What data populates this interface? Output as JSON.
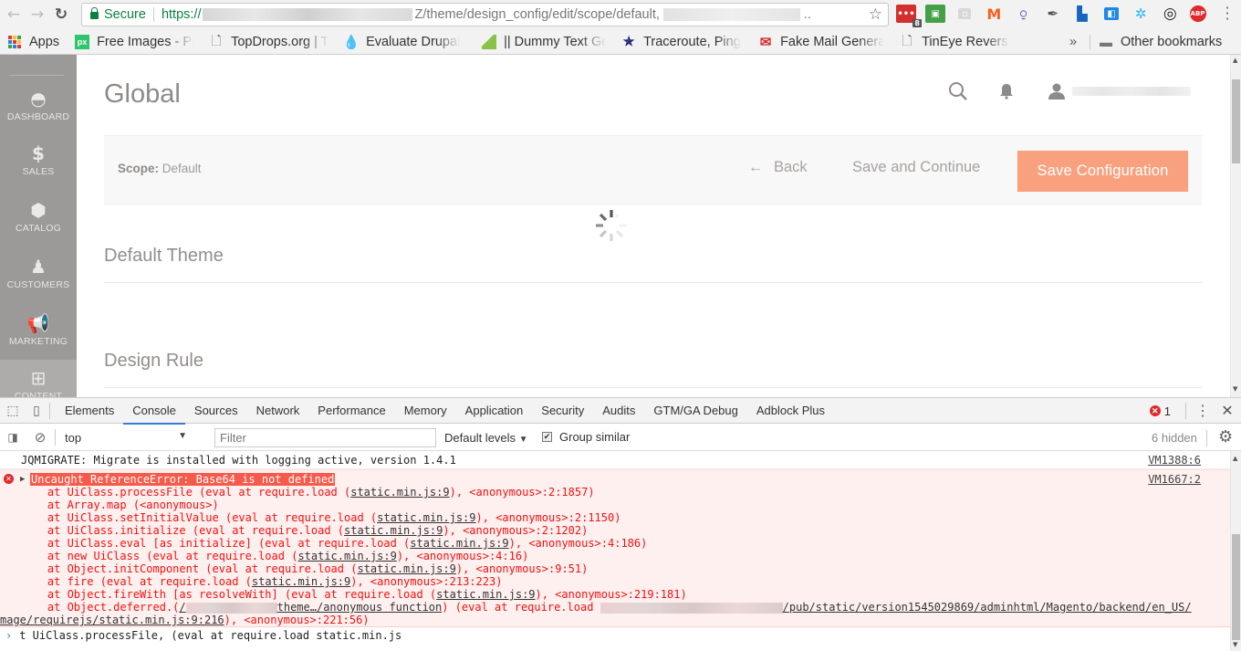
{
  "browser": {
    "omnibox": {
      "secure_label": "Secure",
      "url_scheme": "https://",
      "url_path": "Z/theme/design_config/edit/scope/default,",
      "url_ellipsis": ".."
    },
    "extensions": [
      {
        "name": "lastpass",
        "badge": "8",
        "color": "#d32f2f",
        "glyph": "•••"
      },
      {
        "name": "print-friendly",
        "color": "#43a047",
        "glyph": "🖶"
      },
      {
        "name": "extension-grey",
        "color": "#cfcfcf",
        "glyph": "◘"
      },
      {
        "name": "magento",
        "color": "#f26322",
        "glyph": "M"
      },
      {
        "name": "ruler",
        "color": "#3f51b5",
        "glyph": "8"
      },
      {
        "name": "color-picker",
        "color": "#666",
        "glyph": "✎"
      },
      {
        "name": "device-mode",
        "color": "#1565c0",
        "glyph": "▮"
      },
      {
        "name": "tag-assistant",
        "color": "#1e88e5",
        "glyph": "◧"
      },
      {
        "name": "bug-tracker",
        "color": "#29b6f6",
        "glyph": "✲"
      },
      {
        "name": "link-chain",
        "color": "#222",
        "glyph": "◎"
      },
      {
        "name": "adblock-plus",
        "color": "#e0292b",
        "glyph": "ABP"
      }
    ],
    "bookmarks": [
      {
        "label": "Apps",
        "icon": "apps-grid"
      },
      {
        "label": "Free Images - Pix",
        "icon": "px"
      },
      {
        "label": "TopDrops.org | T",
        "icon": "page"
      },
      {
        "label": "Evaluate Drupal",
        "icon": "drupal"
      },
      {
        "label": "|| Dummy Text Ge",
        "icon": "green"
      },
      {
        "label": "Traceroute, Ping",
        "icon": "star"
      },
      {
        "label": "Fake Mail Genera",
        "icon": "mail"
      },
      {
        "label": "TinEye Reverse Ir",
        "icon": "page"
      }
    ],
    "bookmarks_overflow": "»",
    "other_bookmarks": "Other bookmarks"
  },
  "admin": {
    "menu": [
      {
        "label": "DASHBOARD",
        "icon": "dashboard-icon"
      },
      {
        "label": "SALES",
        "icon": "dollar-icon"
      },
      {
        "label": "CATALOG",
        "icon": "box-icon"
      },
      {
        "label": "CUSTOMERS",
        "icon": "person-icon"
      },
      {
        "label": "MARKETING",
        "icon": "megaphone-icon"
      },
      {
        "label": "CONTENT",
        "icon": "layout-icon"
      }
    ],
    "page_title": "Global",
    "scope_label": "Scope:",
    "scope_value": "Default",
    "back_label": "Back",
    "save_continue_label": "Save and Continue",
    "save_config_label": "Save Configuration",
    "sections": [
      "Default Theme",
      "Design Rule"
    ],
    "colors": {
      "primary_button": "#f9a17f",
      "menu_bg": "#9c9a98"
    }
  },
  "devtools": {
    "tabs": [
      "Elements",
      "Console",
      "Sources",
      "Network",
      "Performance",
      "Memory",
      "Application",
      "Security",
      "Audits",
      "GTM/GA Debug",
      "Adblock Plus"
    ],
    "active_tab": "Console",
    "error_count": "1",
    "context": "top",
    "filter_placeholder": "Filter",
    "levels_label": "Default levels",
    "group_similar_label": "Group similar",
    "group_similar_checked": true,
    "hidden_count": "6 hidden",
    "messages": [
      {
        "type": "log",
        "text": "JQMIGRATE: Migrate is installed with logging active, version 1.4.1",
        "source": "VM1388:6"
      },
      {
        "type": "error",
        "text": "Uncaught ReferenceError: Base64 is not defined",
        "source": "VM1667:2"
      }
    ],
    "stack": [
      {
        "pre": "    at UiClass.processFile (eval at require.load (",
        "link": "static.min.js:9",
        "post": "), <anonymous>:2:1857)"
      },
      {
        "pre": "    at Array.map (<anonymous>)",
        "link": "",
        "post": ""
      },
      {
        "pre": "    at UiClass.setInitialValue (eval at require.load (",
        "link": "static.min.js:9",
        "post": "), <anonymous>:2:1150)"
      },
      {
        "pre": "    at UiClass.initialize (eval at require.load (",
        "link": "static.min.js:9",
        "post": "), <anonymous>:2:1202)"
      },
      {
        "pre": "    at UiClass.eval [as initialize] (eval at require.load (",
        "link": "static.min.js:9",
        "post": "), <anonymous>:4:186)"
      },
      {
        "pre": "    at new UiClass (eval at require.load (",
        "link": "static.min.js:9",
        "post": "), <anonymous>:4:16)"
      },
      {
        "pre": "    at Object.initComponent (eval at require.load (",
        "link": "static.min.js:9",
        "post": "), <anonymous>:9:51)"
      },
      {
        "pre": "    at fire (eval at require.load (",
        "link": "static.min.js:9",
        "post": "), <anonymous>:213:223)"
      },
      {
        "pre": "    at Object.fireWith [as resolveWith] (eval at require.load (",
        "link": "static.min.js:9",
        "post": "), <anonymous>:219:181)"
      }
    ],
    "deferred_line": {
      "pre": "    at Object.deferred.(",
      "link_a": "/",
      "link_b": "theme…/anonymous function",
      "mid": ") (eval at require.load ",
      "link_c": "/pub/static/version1545029869/adminhtml/Magento/backend/en_US/",
      "wrap_link": "mage/requirejs/static.min.js:9:216",
      "wrap_post": "), <anonymous>:221:56)"
    },
    "prompt_text": "t UiClass.processFile, (eval at require.load static.min.js"
  }
}
